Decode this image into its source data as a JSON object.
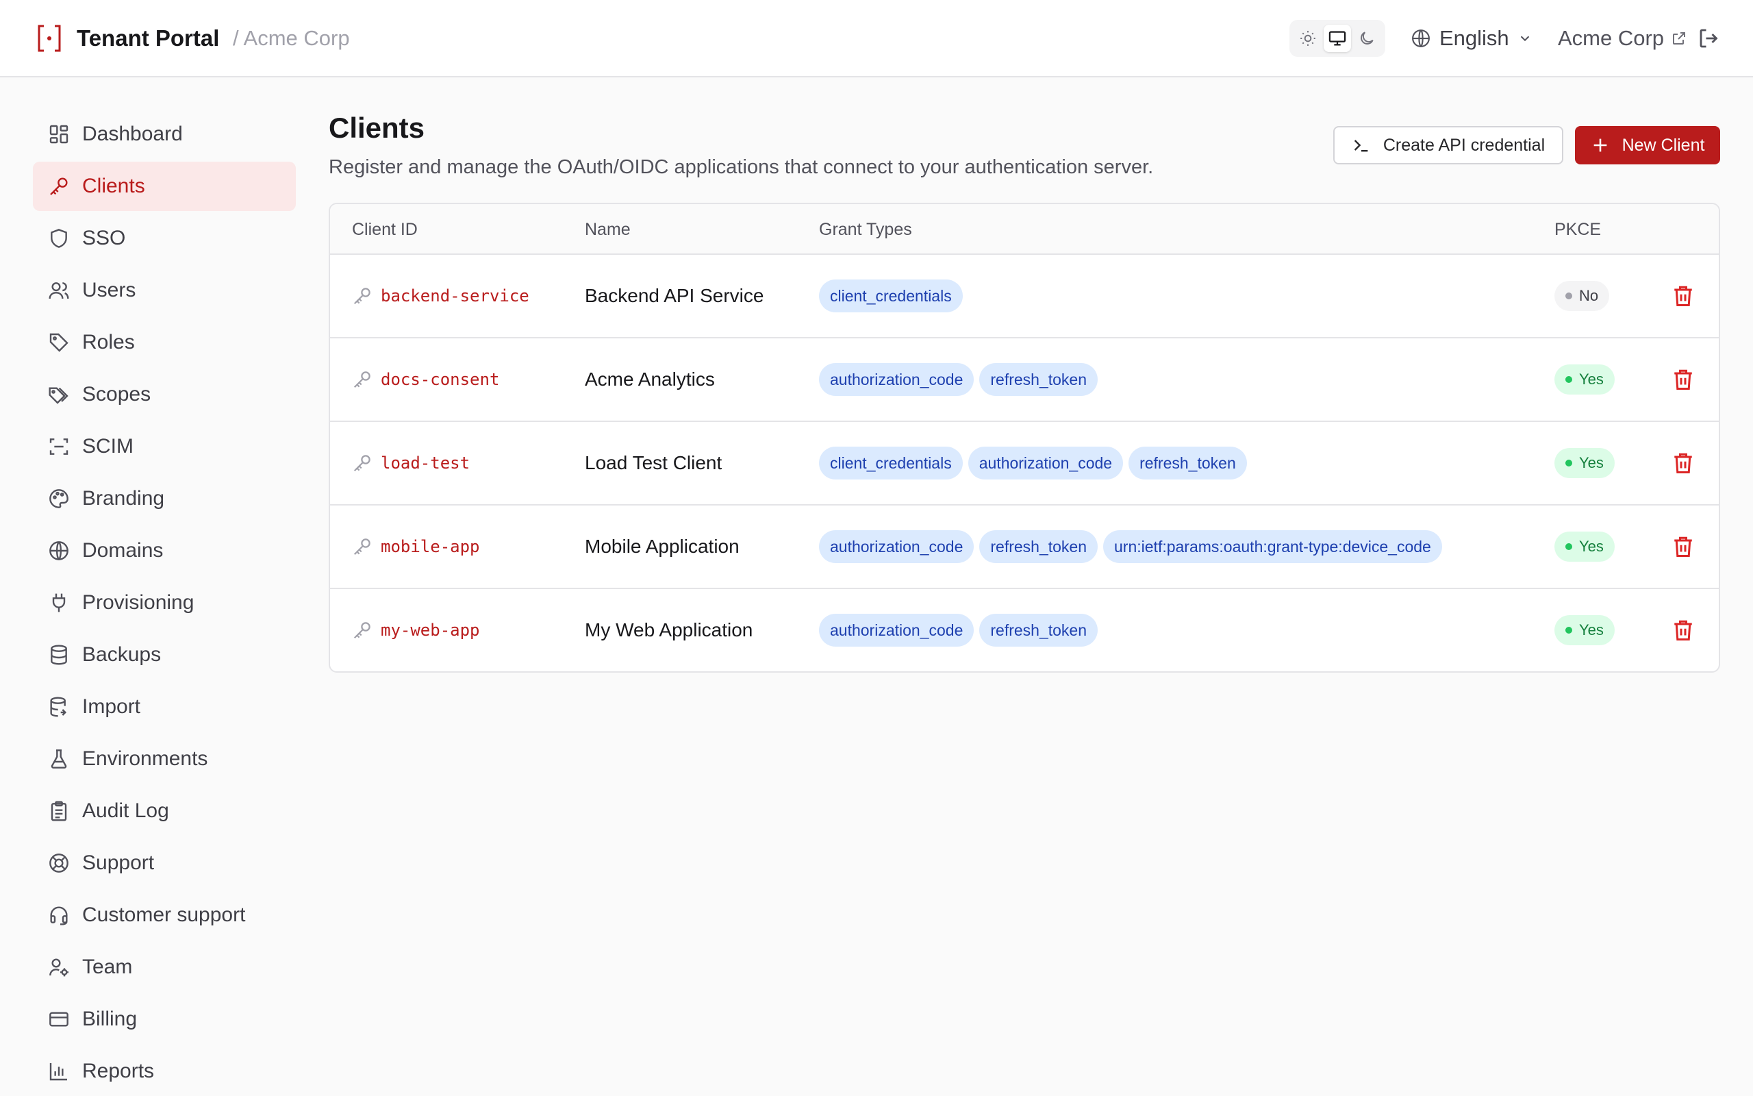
{
  "header": {
    "app_title": "Tenant Portal",
    "breadcrumb": "/ Acme Corp",
    "theme_options": [
      "light",
      "system",
      "dark"
    ],
    "theme_selected": "system",
    "language": "English",
    "tenant": "Acme Corp",
    "icons": {
      "logo": "bracket-logo-icon",
      "language": "globe-icon",
      "tenant": "external-link-icon",
      "logout": "logout-icon"
    }
  },
  "sidebar": {
    "items": [
      {
        "label": "Dashboard",
        "icon": "dashboard-icon",
        "active": false
      },
      {
        "label": "Clients",
        "icon": "key-icon",
        "active": true
      },
      {
        "label": "SSO",
        "icon": "shield-icon",
        "active": false
      },
      {
        "label": "Users",
        "icon": "users-icon",
        "active": false
      },
      {
        "label": "Roles",
        "icon": "tag-icon",
        "active": false
      },
      {
        "label": "Scopes",
        "icon": "tags-icon",
        "active": false
      },
      {
        "label": "SCIM",
        "icon": "scan-icon",
        "active": false
      },
      {
        "label": "Branding",
        "icon": "palette-icon",
        "active": false
      },
      {
        "label": "Domains",
        "icon": "globe-icon",
        "active": false
      },
      {
        "label": "Provisioning",
        "icon": "plug-icon",
        "active": false
      },
      {
        "label": "Backups",
        "icon": "database-icon",
        "active": false
      },
      {
        "label": "Import",
        "icon": "database-import-icon",
        "active": false
      },
      {
        "label": "Environments",
        "icon": "flask-icon",
        "active": false
      },
      {
        "label": "Audit Log",
        "icon": "clipboard-icon",
        "active": false
      },
      {
        "label": "Support",
        "icon": "lifebuoy-icon",
        "active": false
      },
      {
        "label": "Customer support",
        "icon": "headset-icon",
        "active": false
      },
      {
        "label": "Team",
        "icon": "user-cog-icon",
        "active": false
      },
      {
        "label": "Billing",
        "icon": "credit-card-icon",
        "active": false
      },
      {
        "label": "Reports",
        "icon": "bar-chart-icon",
        "active": false
      }
    ]
  },
  "main": {
    "title": "Clients",
    "description": "Register and manage the OAuth/OIDC applications that connect to your authentication server.",
    "create_api_credential_label": "Create API credential",
    "new_client_label": "New Client"
  },
  "table": {
    "headers": {
      "client_id": "Client ID",
      "name": "Name",
      "grant_types": "Grant Types",
      "pkce": "PKCE"
    },
    "rows": [
      {
        "client_id": "backend-service",
        "name": "Backend API Service",
        "grant_types": [
          "client_credentials"
        ],
        "pkce": "No"
      },
      {
        "client_id": "docs-consent",
        "name": "Acme Analytics",
        "grant_types": [
          "authorization_code",
          "refresh_token"
        ],
        "pkce": "Yes"
      },
      {
        "client_id": "load-test",
        "name": "Load Test Client",
        "grant_types": [
          "client_credentials",
          "authorization_code",
          "refresh_token"
        ],
        "pkce": "Yes"
      },
      {
        "client_id": "mobile-app",
        "name": "Mobile Application",
        "grant_types": [
          "authorization_code",
          "refresh_token",
          "urn:ietf:params:oauth:grant-type:device_code"
        ],
        "pkce": "Yes"
      },
      {
        "client_id": "my-web-app",
        "name": "My Web Application",
        "grant_types": [
          "authorization_code",
          "refresh_token"
        ],
        "pkce": "Yes"
      }
    ]
  },
  "colors": {
    "brand": "#b91c1c",
    "active_nav_bg": "#fbe8e8",
    "chip_bg": "#dbeafe",
    "chip_text": "#1e40af",
    "pkce_yes": "#22c55e",
    "pkce_no": "#a1a1aa"
  }
}
